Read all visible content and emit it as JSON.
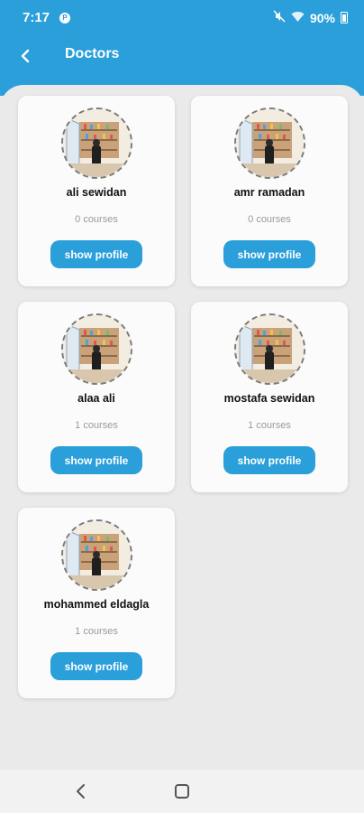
{
  "status_bar": {
    "time": "7:17",
    "battery": "90%"
  },
  "app_bar": {
    "title": "Doctors"
  },
  "doctors": [
    {
      "name": "ali sewidan",
      "courses": "0 courses",
      "button": "show profile"
    },
    {
      "name": "amr ramadan",
      "courses": "0 courses",
      "button": "show profile"
    },
    {
      "name": "alaa ali",
      "courses": "1 courses",
      "button": "show profile"
    },
    {
      "name": "mostafa sewidan",
      "courses": "1 courses",
      "button": "show profile"
    },
    {
      "name": "mohammed eldagla",
      "courses": "1 courses",
      "button": "show profile"
    }
  ],
  "colors": {
    "primary": "#2a9fda",
    "background": "#eaeaea",
    "card": "#fbfbfb"
  }
}
